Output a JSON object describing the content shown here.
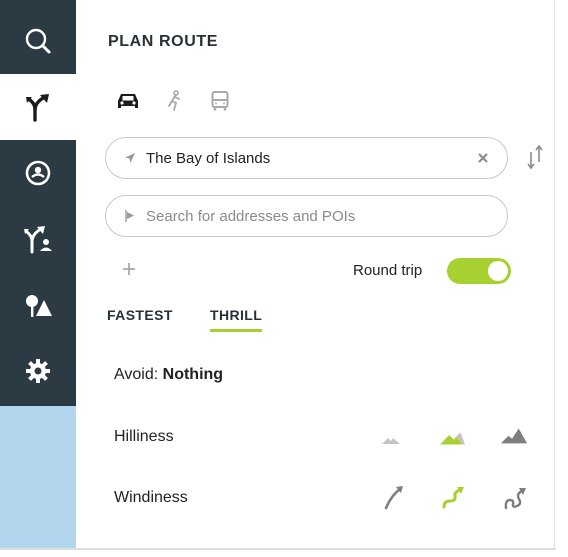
{
  "panel": {
    "title": "PLAN ROUTE"
  },
  "modes": [
    {
      "icon": "car-icon",
      "selected": true
    },
    {
      "icon": "bicycle-icon",
      "selected": false
    },
    {
      "icon": "bus-icon",
      "selected": false
    }
  ],
  "route": {
    "start_value": "The Bay of Islands",
    "destination_placeholder": "Search for addresses and POIs",
    "round_trip_label": "Round trip",
    "round_trip_on": true
  },
  "tabs": [
    {
      "label": "FASTEST",
      "active": false
    },
    {
      "label": "THRILL",
      "active": true
    }
  ],
  "avoid": {
    "label": "Avoid:",
    "value": "Nothing"
  },
  "hilliness": {
    "label": "Hilliness",
    "options": [
      "low-hills-icon",
      "medium-hills-icon",
      "high-hills-icon"
    ],
    "selected_index": 1
  },
  "windiness": {
    "label": "Windiness",
    "options": [
      "straight-road-icon",
      "curvy-road-icon",
      "very-curvy-road-icon"
    ],
    "selected_index": 1
  },
  "colors": {
    "rail": "#2c3a43",
    "accent": "#a6d130",
    "rail_fill": "#b3d6ef"
  }
}
